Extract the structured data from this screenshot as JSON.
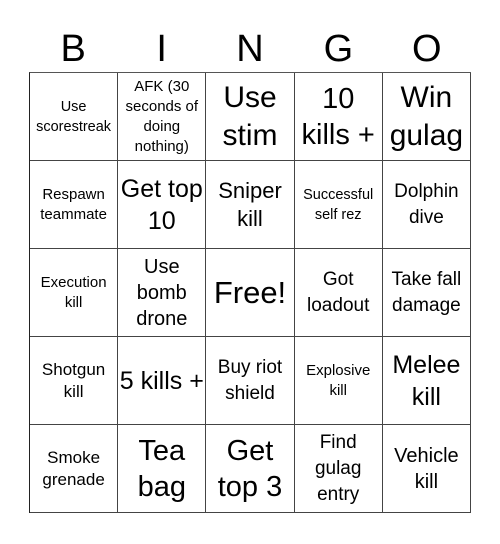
{
  "title_letters": [
    "B",
    "I",
    "N",
    "G",
    "O"
  ],
  "grid": [
    [
      "Use scorestreak",
      "AFK (30 seconds of doing nothing)",
      "Use stim",
      "10 kills +",
      "Win gulag"
    ],
    [
      "Respawn teammate",
      "Get top 10",
      "Sniper kill",
      "Successful self rez",
      "Dolphin dive"
    ],
    [
      "Execution kill",
      "Use bomb drone",
      "Free!",
      "Got loadout",
      "Take fall damage"
    ],
    [
      "Shotgun kill",
      "5 kills +",
      "Buy riot shield",
      "Explosive kill",
      "Melee kill"
    ],
    [
      "Smoke grenade",
      "Tea bag",
      "Get top 3",
      "Find gulag entry",
      "Vehicle kill"
    ]
  ],
  "free_space": "Free!"
}
